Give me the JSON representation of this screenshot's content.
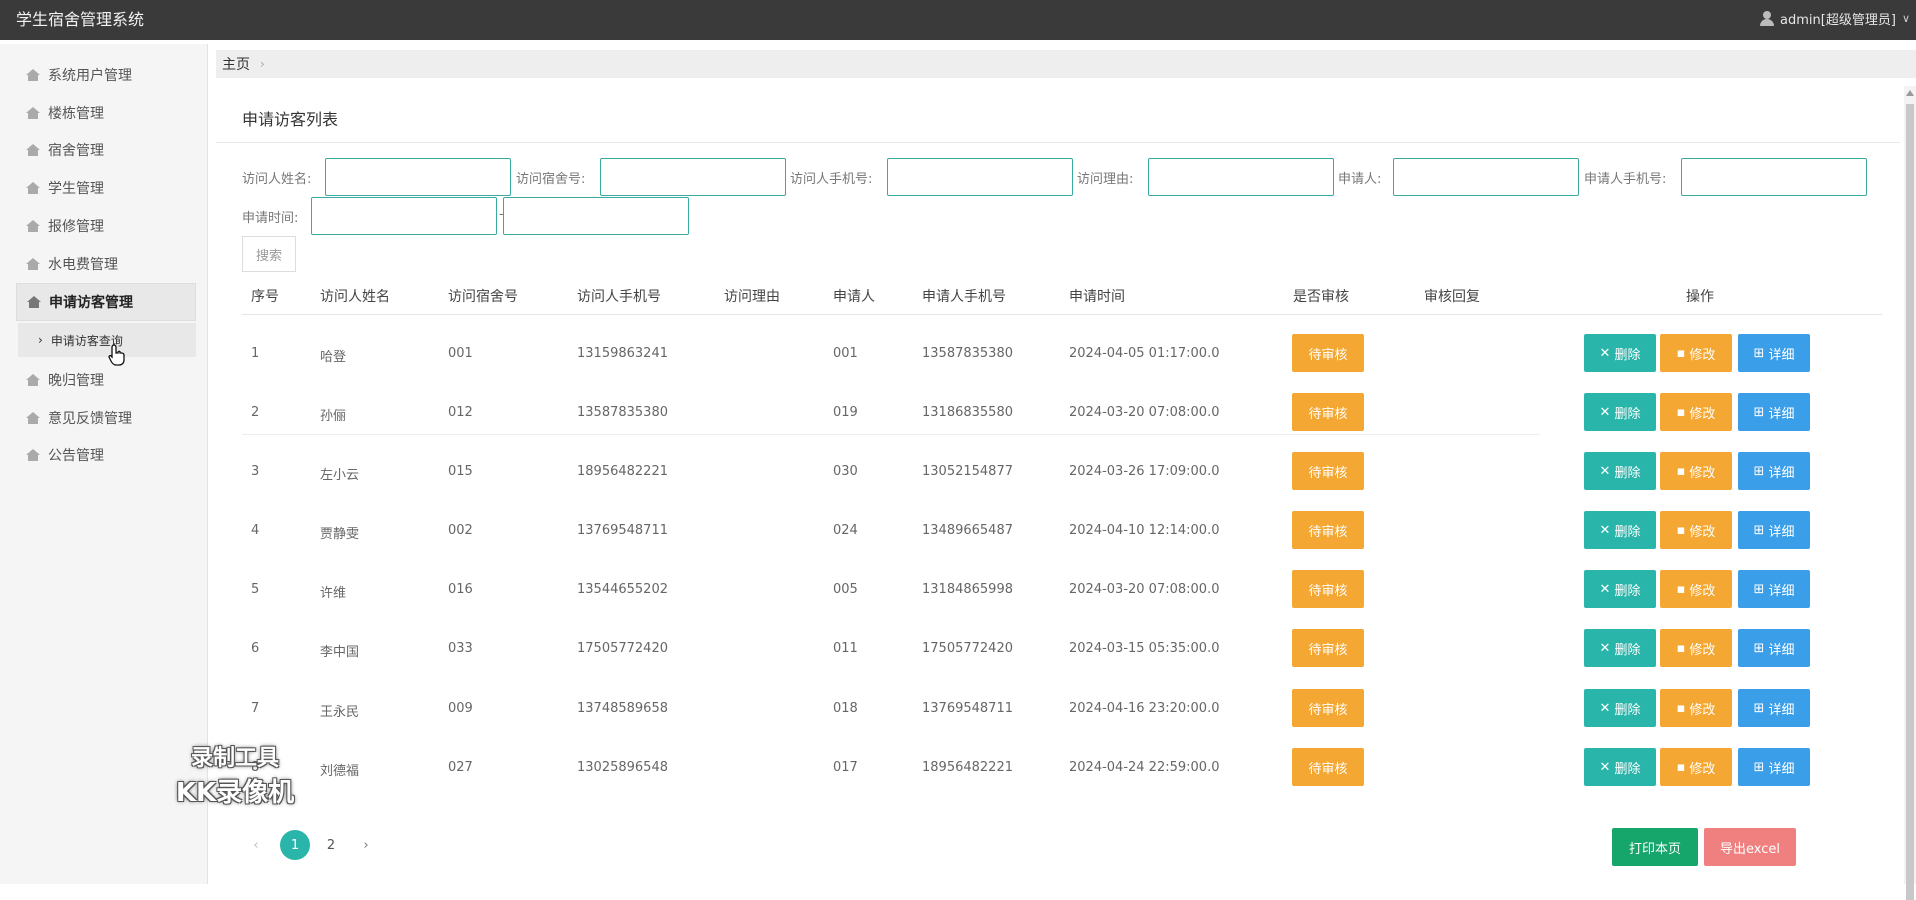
{
  "app": {
    "title": "学生宿舍管理系统",
    "user": "admin[超级管理员]"
  },
  "sidebar": {
    "items": [
      {
        "label": "系统用户管理"
      },
      {
        "label": "楼栋管理"
      },
      {
        "label": "宿舍管理"
      },
      {
        "label": "学生管理"
      },
      {
        "label": "报修管理"
      },
      {
        "label": "水电费管理"
      },
      {
        "label": "申请访客管理"
      },
      {
        "label": "晚归管理"
      },
      {
        "label": "意见反馈管理"
      },
      {
        "label": "公告管理"
      }
    ],
    "sub_item": "申请访客查询"
  },
  "breadcrumb": {
    "home": "主页"
  },
  "panel": {
    "title": "申请访客列表"
  },
  "filters": {
    "visitor_name": "访问人姓名:",
    "dorm_no": "访问宿舍号:",
    "visitor_phone": "访问人手机号:",
    "reason": "访问理由:",
    "applicant": "申请人:",
    "applicant_phone": "申请人手机号:",
    "apply_time": "申请时间:",
    "dash": "-",
    "search": "搜索"
  },
  "table": {
    "headers": [
      "序号",
      "访问人姓名",
      "访问宿舍号",
      "访问人手机号",
      "访问理由",
      "申请人",
      "申请人手机号",
      "申请时间",
      "是否审核",
      "审核回复",
      "操作"
    ],
    "rows": [
      {
        "no": "1",
        "name": "哈登",
        "dorm": "001",
        "phone": "13159863241",
        "reason": "",
        "applicant": "001",
        "aphone": "13587835380",
        "time": "2024-04-05 01:17:00.0",
        "audit": "待审核",
        "reply": ""
      },
      {
        "no": "2",
        "name": "孙俪",
        "dorm": "012",
        "phone": "13587835380",
        "reason": "",
        "applicant": "019",
        "aphone": "13186835580",
        "time": "2024-03-20 07:08:00.0",
        "audit": "待审核",
        "reply": ""
      },
      {
        "no": "3",
        "name": "左小云",
        "dorm": "015",
        "phone": "18956482221",
        "reason": "",
        "applicant": "030",
        "aphone": "13052154877",
        "time": "2024-03-26 17:09:00.0",
        "audit": "待审核",
        "reply": ""
      },
      {
        "no": "4",
        "name": "贾静雯",
        "dorm": "002",
        "phone": "13769548711",
        "reason": "",
        "applicant": "024",
        "aphone": "13489665487",
        "time": "2024-04-10 12:14:00.0",
        "audit": "待审核",
        "reply": ""
      },
      {
        "no": "5",
        "name": "许维",
        "dorm": "016",
        "phone": "13544655202",
        "reason": "",
        "applicant": "005",
        "aphone": "13184865998",
        "time": "2024-03-20 07:08:00.0",
        "audit": "待审核",
        "reply": ""
      },
      {
        "no": "6",
        "name": "李中国",
        "dorm": "033",
        "phone": "17505772420",
        "reason": "",
        "applicant": "011",
        "aphone": "17505772420",
        "time": "2024-03-15 05:35:00.0",
        "audit": "待审核",
        "reply": ""
      },
      {
        "no": "7",
        "name": "王永民",
        "dorm": "009",
        "phone": "13748589658",
        "reason": "",
        "applicant": "018",
        "aphone": "13769548711",
        "time": "2024-04-16 23:20:00.0",
        "audit": "待审核",
        "reply": ""
      },
      {
        "no": "8",
        "name": "刘德福",
        "dorm": "027",
        "phone": "13025896548",
        "reason": "",
        "applicant": "017",
        "aphone": "18956482221",
        "time": "2024-04-24 22:59:00.0",
        "audit": "待审核",
        "reply": ""
      }
    ],
    "ops": {
      "delete": "删除",
      "edit": "修改",
      "detail": "详细"
    }
  },
  "pager": {
    "prev": "‹",
    "p1": "1",
    "p2": "2",
    "next": "›"
  },
  "footer": {
    "print": "打印本页",
    "export": "导出excel"
  },
  "watermark": {
    "line1": "录制工具",
    "line2": "KK录像机"
  }
}
